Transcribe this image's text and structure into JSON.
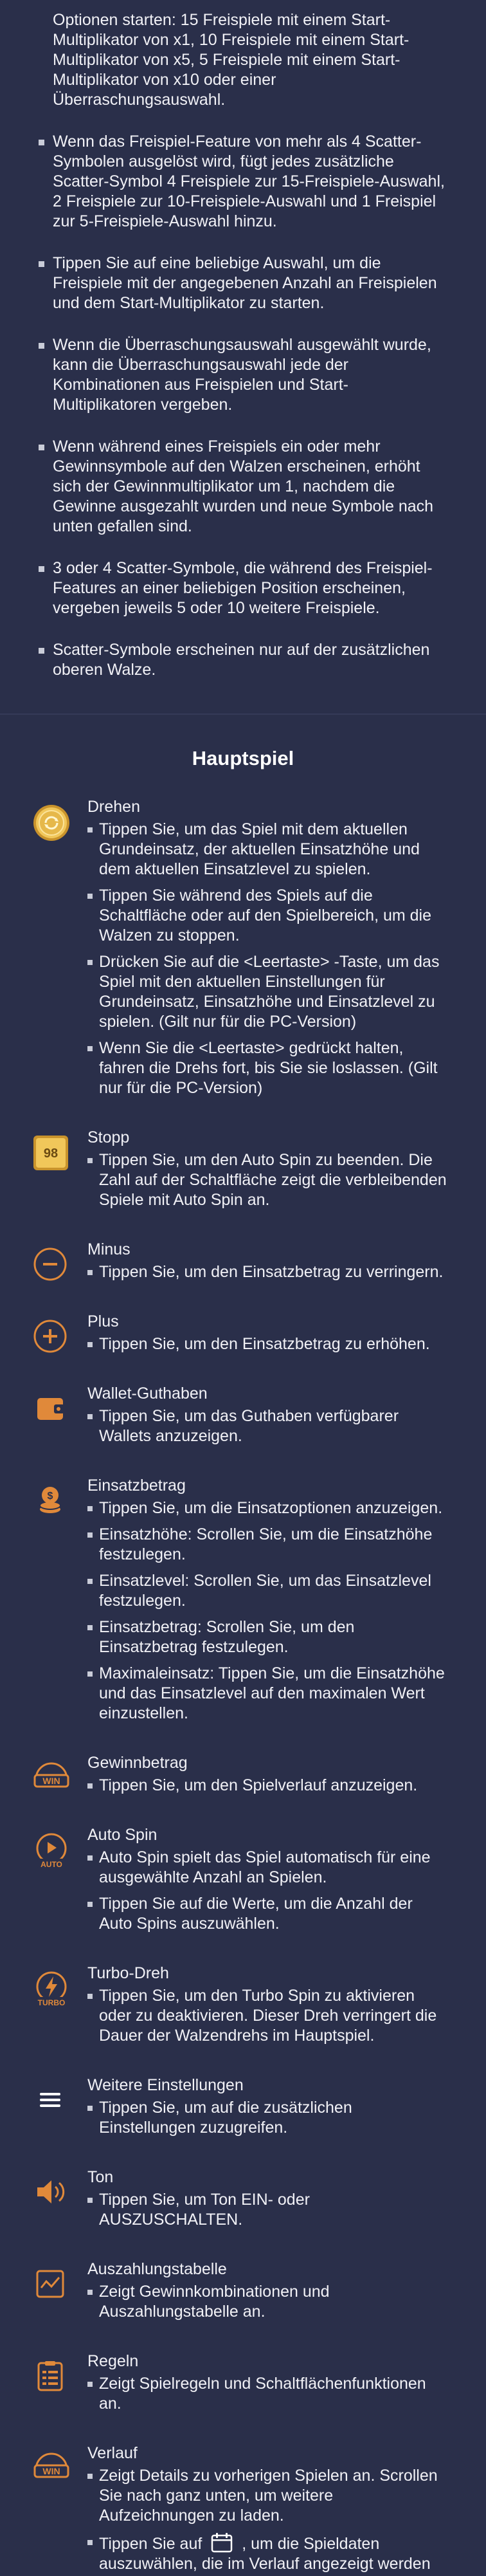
{
  "rules": {
    "items": [
      "Optionen starten: 15 Freispiele mit einem Start-Multiplikator von x1, 10 Freispiele mit einem Start-Multiplikator von x5, 5 Freispiele mit einem Start-Multiplikator von x10 oder einer Überraschungsauswahl.",
      "Wenn das Freispiel-Feature von mehr als 4 Scatter-Symbolen ausgelöst wird, fügt jedes zusätzliche Scatter-Symbol 4 Freispiele zur 15-Freispiele-Auswahl, 2 Freispiele zur 10-Freispiele-Auswahl und 1 Freispiel zur 5-Freispiele-Auswahl hinzu.",
      "Tippen Sie auf eine beliebige Auswahl, um die Freispiele mit der angegebenen Anzahl an Freispielen und dem Start-Multiplikator zu starten.",
      "Wenn die Überraschungsauswahl ausgewählt wurde, kann die Überraschungsauswahl jede der Kombinationen aus Freispielen und Start-Multiplikatoren vergeben.",
      "Wenn während eines Freispiels ein oder mehr Gewinnsymbole auf den Walzen erscheinen, erhöht sich der Gewinnmultiplikator um 1, nachdem die Gewinne ausgezahlt wurden und neue Symbole nach unten gefallen sind.",
      "3 oder 4 Scatter-Symbole, die während des Freispiel-Features an einer beliebigen Position erscheinen, vergeben jeweils 5 oder 10 weitere Freispiele.",
      "Scatter-Symbole erscheinen nur auf der zusätzlichen oberen Walze."
    ]
  },
  "main": {
    "title": "Hauptspiel",
    "sections": [
      {
        "title": "Drehen",
        "icon": "spin-coin-icon",
        "bullets": [
          "Tippen Sie, um das Spiel mit dem aktuellen Grundeinsatz, der aktuellen Einsatzhöhe und dem aktuellen Einsatzlevel zu spielen.",
          "Tippen Sie während des Spiels auf die Schaltfläche oder auf den Spielbereich, um die Walzen zu stoppen.",
          "Drücken Sie auf die <Leertaste> -Taste, um das Spiel mit den aktuellen Einstellungen für Grundeinsatz, Einsatzhöhe und Einsatzlevel zu spielen. (Gilt nur für die PC-Version)",
          "Wenn Sie die <Leertaste> gedrückt halten, fahren die Drehs fort, bis Sie sie loslassen. (Gilt nur für die PC-Version)"
        ]
      },
      {
        "title": "Stopp",
        "icon": "stop-badge-icon",
        "badge": "98",
        "bullets": [
          "Tippen Sie, um den Auto Spin zu beenden. Die Zahl auf der Schaltfläche zeigt die verbleibenden Spiele mit Auto Spin an."
        ]
      },
      {
        "title": "Minus",
        "icon": "minus-icon",
        "bullets": [
          "Tippen Sie, um den Einsatzbetrag zu verringern."
        ]
      },
      {
        "title": "Plus",
        "icon": "plus-icon",
        "bullets": [
          "Tippen Sie, um den Einsatzbetrag zu erhöhen."
        ]
      },
      {
        "title": "Wallet-Guthaben",
        "icon": "wallet-icon",
        "bullets": [
          "Tippen Sie, um das Guthaben verfügbarer Wallets anzuzeigen."
        ]
      },
      {
        "title": "Einsatzbetrag",
        "icon": "coin-stack-icon",
        "bullets": [
          "Tippen Sie, um die Einsatzoptionen anzuzeigen.",
          "Einsatzhöhe: Scrollen Sie, um die Einsatzhöhe festzulegen.",
          "Einsatzlevel: Scrollen Sie, um das Einsatzlevel festzulegen.",
          "Einsatzbetrag: Scrollen Sie, um den Einsatzbetrag festzulegen.",
          "Maximaleinsatz: Tippen Sie, um die Einsatzhöhe und das Einsatzlevel auf den maximalen Wert einzustellen."
        ]
      },
      {
        "title": "Gewinnbetrag",
        "icon": "win-icon",
        "label": "WIN",
        "bullets": [
          "Tippen Sie, um den Spielverlauf anzuzeigen."
        ]
      },
      {
        "title": "Auto Spin",
        "icon": "auto-spin-icon",
        "label": "AUTO",
        "bullets": [
          "Auto Spin spielt das Spiel automatisch für eine ausgewählte Anzahl an Spielen.",
          "Tippen Sie auf die Werte, um die Anzahl der Auto Spins auszuwählen."
        ]
      },
      {
        "title": "Turbo-Dreh",
        "icon": "turbo-icon",
        "label": "TURBO",
        "bullets": [
          "Tippen Sie, um den Turbo Spin zu aktivieren oder zu deaktivieren. Dieser Dreh verringert die Dauer der Walzendrehs im Hauptspiel."
        ]
      },
      {
        "title": "Weitere Einstellungen",
        "icon": "menu-icon",
        "bullets": [
          "Tippen Sie, um auf die zusätzlichen Einstellungen zuzugreifen."
        ]
      },
      {
        "title": "Ton",
        "icon": "speaker-icon",
        "bullets": [
          "Tippen Sie, um Ton EIN- oder AUSZUSCHALTEN."
        ]
      },
      {
        "title": "Auszahlungstabelle",
        "icon": "paytable-icon",
        "bullets": [
          "Zeigt Gewinnkombinationen und Auszahlungstabelle an."
        ]
      },
      {
        "title": "Regeln",
        "icon": "rules-icon",
        "bullets": [
          "Zeigt Spielregeln und Schaltflächenfunktionen an."
        ]
      },
      {
        "title": "Verlauf",
        "icon": "history-icon",
        "label": "WIN",
        "bullets": [
          "Zeigt Details zu vorherigen Spielen an. Scrollen Sie nach ganz unten, um weitere Aufzeichnungen zu laden."
        ],
        "last_bullet_before": "Tippen Sie auf",
        "last_bullet_after": ", um die Spieldaten auszuwählen, die im Verlauf angezeigt werden sollen."
      }
    ]
  },
  "colors": {
    "background": "#2a2f4a",
    "icon_orange": "#e0893a",
    "icon_gold": "#e6b84a",
    "bullet": "#c9ccd8"
  }
}
